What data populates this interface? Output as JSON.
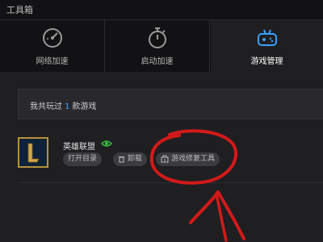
{
  "window": {
    "title": "工具箱"
  },
  "tabs": [
    {
      "label": "网络加速",
      "icon": "speedometer-icon",
      "active": false
    },
    {
      "label": "启动加速",
      "icon": "stopwatch-icon",
      "active": false
    },
    {
      "label": "游戏管理",
      "icon": "gamepad-icon",
      "active": true
    }
  ],
  "summary": {
    "prefix": "我共玩过",
    "count": "1",
    "suffix": "款游戏"
  },
  "game": {
    "name": "英雄联盟",
    "icon": "league-of-legends-icon",
    "actions": [
      {
        "label": "打开目录",
        "icon": ""
      },
      {
        "label": "卸载",
        "icon": "trash-icon"
      },
      {
        "label": "游戏修复工具",
        "icon": "repair-toolbox-icon"
      }
    ]
  },
  "colors": {
    "accent": "#3aa0ff",
    "eye": "#36c13f",
    "annotation": "#d21a1a",
    "game_icon_border": "#b6913a"
  }
}
